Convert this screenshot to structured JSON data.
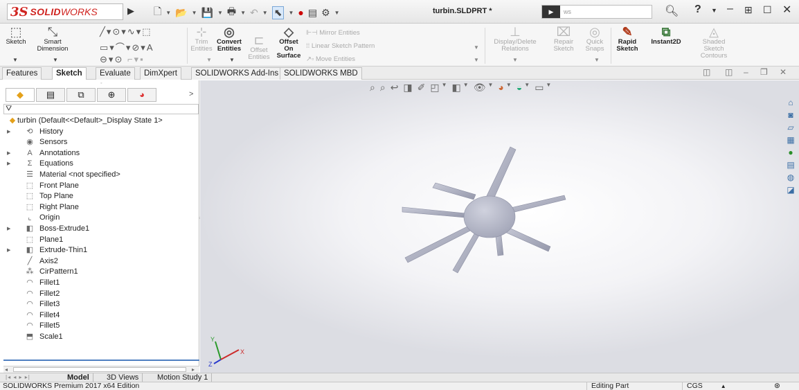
{
  "titlebar": {
    "logo_ds": "3S",
    "logo_solid": "SOLID",
    "logo_works": "WORKS",
    "doc_title": "turbin.SLDPRT *",
    "search_placeholder": "ws",
    "help": "?",
    "qat_icons": [
      "new-file-icon",
      "open-file-icon",
      "save-icon",
      "print-icon",
      "undo-icon",
      "select-icon",
      "rebuild-icon",
      "file-properties-icon",
      "options-icon"
    ]
  },
  "ribbon": {
    "sketch": "Sketch",
    "smart_dimension_1": "Smart",
    "smart_dimension_2": "Dimension",
    "trim_1": "Trim",
    "trim_2": "Entities",
    "convert_1": "Convert",
    "convert_2": "Entities",
    "offset_1": "Offset",
    "offset_2": "Entities",
    "offset_surface_1": "Offset",
    "offset_surface_2": "On",
    "offset_surface_3": "Surface",
    "mirror": "Mirror Entities",
    "linear_pattern": "Linear Sketch Pattern",
    "move": "Move Entities",
    "display_delete_1": "Display/Delete",
    "display_delete_2": "Relations",
    "repair_1": "Repair",
    "repair_2": "Sketch",
    "quick_snaps_1": "Quick",
    "quick_snaps_2": "Snaps",
    "rapid_1": "Rapid",
    "rapid_2": "Sketch",
    "instant2d": "Instant2D",
    "shaded_1": "Shaded",
    "shaded_2": "Sketch",
    "shaded_3": "Contours"
  },
  "tabs": [
    "Features",
    "Sketch",
    "Evaluate",
    "DimXpert",
    "SOLIDWORKS Add-Ins",
    "SOLIDWORKS MBD"
  ],
  "active_tab": "Sketch",
  "feature_tree": {
    "root": "turbin  (Default<<Default>_Display State 1>",
    "items": [
      {
        "label": "History",
        "icon": "history-icon",
        "expandable": true
      },
      {
        "label": "Sensors",
        "icon": "sensors-icon",
        "expandable": false
      },
      {
        "label": "Annotations",
        "icon": "annotations-icon",
        "expandable": true
      },
      {
        "label": "Equations",
        "icon": "equations-icon",
        "expandable": true
      },
      {
        "label": "Material <not specified>",
        "icon": "material-icon",
        "expandable": false
      },
      {
        "label": "Front Plane",
        "icon": "plane-icon",
        "expandable": false
      },
      {
        "label": "Top Plane",
        "icon": "plane-icon",
        "expandable": false
      },
      {
        "label": "Right Plane",
        "icon": "plane-icon",
        "expandable": false
      },
      {
        "label": "Origin",
        "icon": "origin-icon",
        "expandable": false
      },
      {
        "label": "Boss-Extrude1",
        "icon": "extrude-icon",
        "expandable": true
      },
      {
        "label": "Plane1",
        "icon": "plane-icon",
        "expandable": false
      },
      {
        "label": "Extrude-Thin1",
        "icon": "extrude-icon",
        "expandable": true
      },
      {
        "label": "Axis2",
        "icon": "axis-icon",
        "expandable": false
      },
      {
        "label": "CirPattern1",
        "icon": "circular-pattern-icon",
        "expandable": false
      },
      {
        "label": "Fillet1",
        "icon": "fillet-icon",
        "expandable": false
      },
      {
        "label": "Fillet2",
        "icon": "fillet-icon",
        "expandable": false
      },
      {
        "label": "Fillet3",
        "icon": "fillet-icon",
        "expandable": false
      },
      {
        "label": "Fillet4",
        "icon": "fillet-icon",
        "expandable": false
      },
      {
        "label": "Fillet5",
        "icon": "fillet-icon",
        "expandable": false
      },
      {
        "label": "Scale1",
        "icon": "scale-icon",
        "expandable": false
      }
    ]
  },
  "bottom_tabs": [
    "Model",
    "3D Views",
    "Motion Study 1"
  ],
  "status": {
    "edition": "SOLIDWORKS Premium 2017 x64 Edition",
    "mode": "Editing Part",
    "units": "CGS"
  },
  "triad": {
    "x": "X",
    "y": "Y",
    "z": "Z"
  },
  "colors": {
    "brand_red": "#d02420",
    "part_color": "#b8bacb",
    "selection_blue": "#4f7fc0"
  }
}
